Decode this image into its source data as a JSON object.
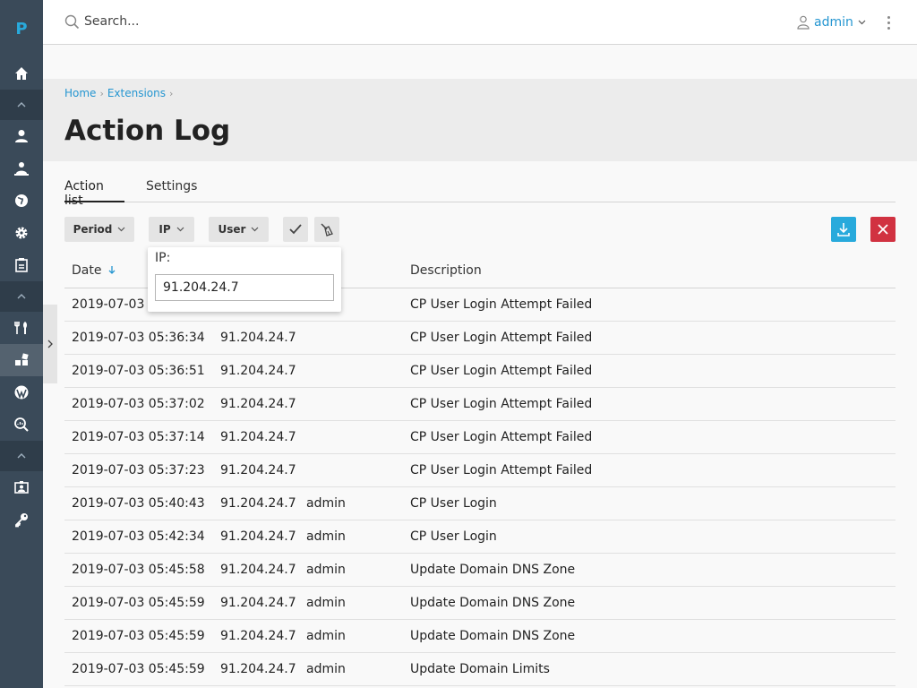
{
  "app": {
    "logo_letter": "P"
  },
  "topbar": {
    "search_placeholder": "Search...",
    "user_name": "admin"
  },
  "breadcrumb": {
    "items": [
      "Home",
      "Extensions"
    ]
  },
  "page": {
    "title": "Action Log"
  },
  "tabs": [
    {
      "label": "Action list",
      "active": true
    },
    {
      "label": "Settings",
      "active": false
    }
  ],
  "toolbar": {
    "period_label": "Period",
    "ip_label": "IP",
    "user_label": "User"
  },
  "ip_filter": {
    "label": "IP:",
    "value": "91.204.24.7"
  },
  "table": {
    "columns": [
      "Date",
      "Description"
    ],
    "rows": [
      {
        "date": "2019-07-03 0",
        "ip": "",
        "user": "",
        "description": "CP User Login Attempt Failed"
      },
      {
        "date": "2019-07-03 05:36:34",
        "ip": "91.204.24.7",
        "user": "",
        "description": "CP User Login Attempt Failed"
      },
      {
        "date": "2019-07-03 05:36:51",
        "ip": "91.204.24.7",
        "user": "",
        "description": "CP User Login Attempt Failed"
      },
      {
        "date": "2019-07-03 05:37:02",
        "ip": "91.204.24.7",
        "user": "",
        "description": "CP User Login Attempt Failed"
      },
      {
        "date": "2019-07-03 05:37:14",
        "ip": "91.204.24.7",
        "user": "",
        "description": "CP User Login Attempt Failed"
      },
      {
        "date": "2019-07-03 05:37:23",
        "ip": "91.204.24.7",
        "user": "",
        "description": "CP User Login Attempt Failed"
      },
      {
        "date": "2019-07-03 05:40:43",
        "ip": "91.204.24.7",
        "user": "admin",
        "description": "CP User Login"
      },
      {
        "date": "2019-07-03 05:42:34",
        "ip": "91.204.24.7",
        "user": "admin",
        "description": "CP User Login"
      },
      {
        "date": "2019-07-03 05:45:58",
        "ip": "91.204.24.7",
        "user": "admin",
        "description": "Update Domain DNS Zone"
      },
      {
        "date": "2019-07-03 05:45:59",
        "ip": "91.204.24.7",
        "user": "admin",
        "description": "Update Domain DNS Zone"
      },
      {
        "date": "2019-07-03 05:45:59",
        "ip": "91.204.24.7",
        "user": "admin",
        "description": "Update Domain DNS Zone"
      },
      {
        "date": "2019-07-03 05:45:59",
        "ip": "91.204.24.7",
        "user": "admin",
        "description": "Update Domain Limits"
      }
    ]
  },
  "colors": {
    "sidebar_bg": "#3a4a59",
    "accent": "#28aadc",
    "link": "#2596d1",
    "danger": "#d13241"
  },
  "icons": {
    "sidebar": [
      "home-icon",
      "user-icon",
      "users-icon",
      "globe-icon",
      "gear-icon",
      "statistics-icon",
      "tools-icon",
      "extensions-icon",
      "wordpress-icon",
      "seo-icon",
      "profile-icon",
      "key-icon"
    ]
  }
}
